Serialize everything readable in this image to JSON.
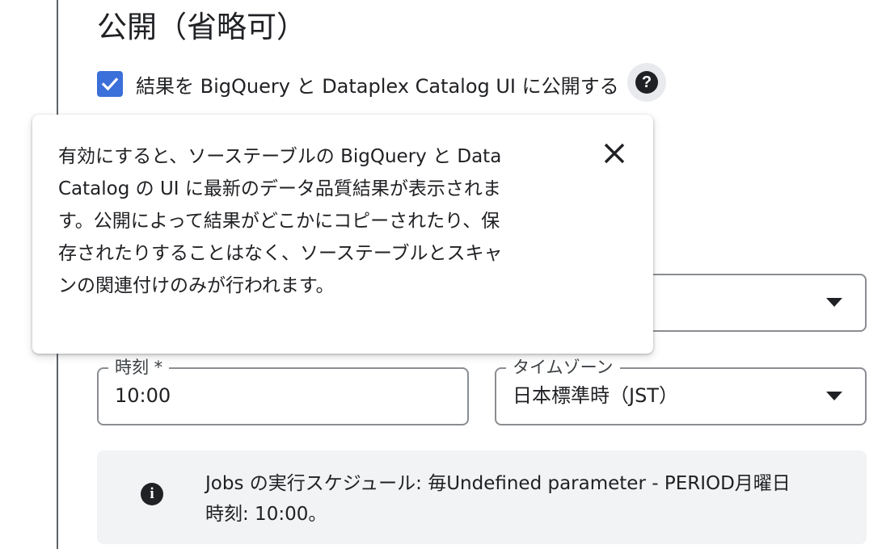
{
  "section": {
    "title": "公開（省略可）"
  },
  "publish": {
    "checked": true,
    "label": "結果を BigQuery と Dataplex Catalog UI に公開する",
    "help_icon": "help-circle-icon"
  },
  "tooltip": {
    "lines": [
      "有効にすると、ソーステーブルの BigQuery と Data",
      "Catalog の UI に最新のデータ品質結果が表示されま",
      "す。公開によって結果がどこかにコピーされたり、保",
      "存されたりすることはなく、ソーステーブルとスキャ",
      "ンの関連付けのみが行われます。"
    ],
    "close_icon": "close-icon"
  },
  "schedule": {
    "time": {
      "label": "時刻 *",
      "value": "10:00"
    },
    "timezone": {
      "label": "タイムゾーン",
      "value": "日本標準時（JST）"
    }
  },
  "info": {
    "icon": "info-icon",
    "lines": [
      "Jobs の実行スケジュール: 毎Undefined parameter - PERIOD月曜日",
      "時刻: 10:00。"
    ]
  },
  "colors": {
    "accent": "#3b6fd9",
    "border": "#8a8d91",
    "info_bg": "#f1f3f4",
    "text": "#202124"
  }
}
